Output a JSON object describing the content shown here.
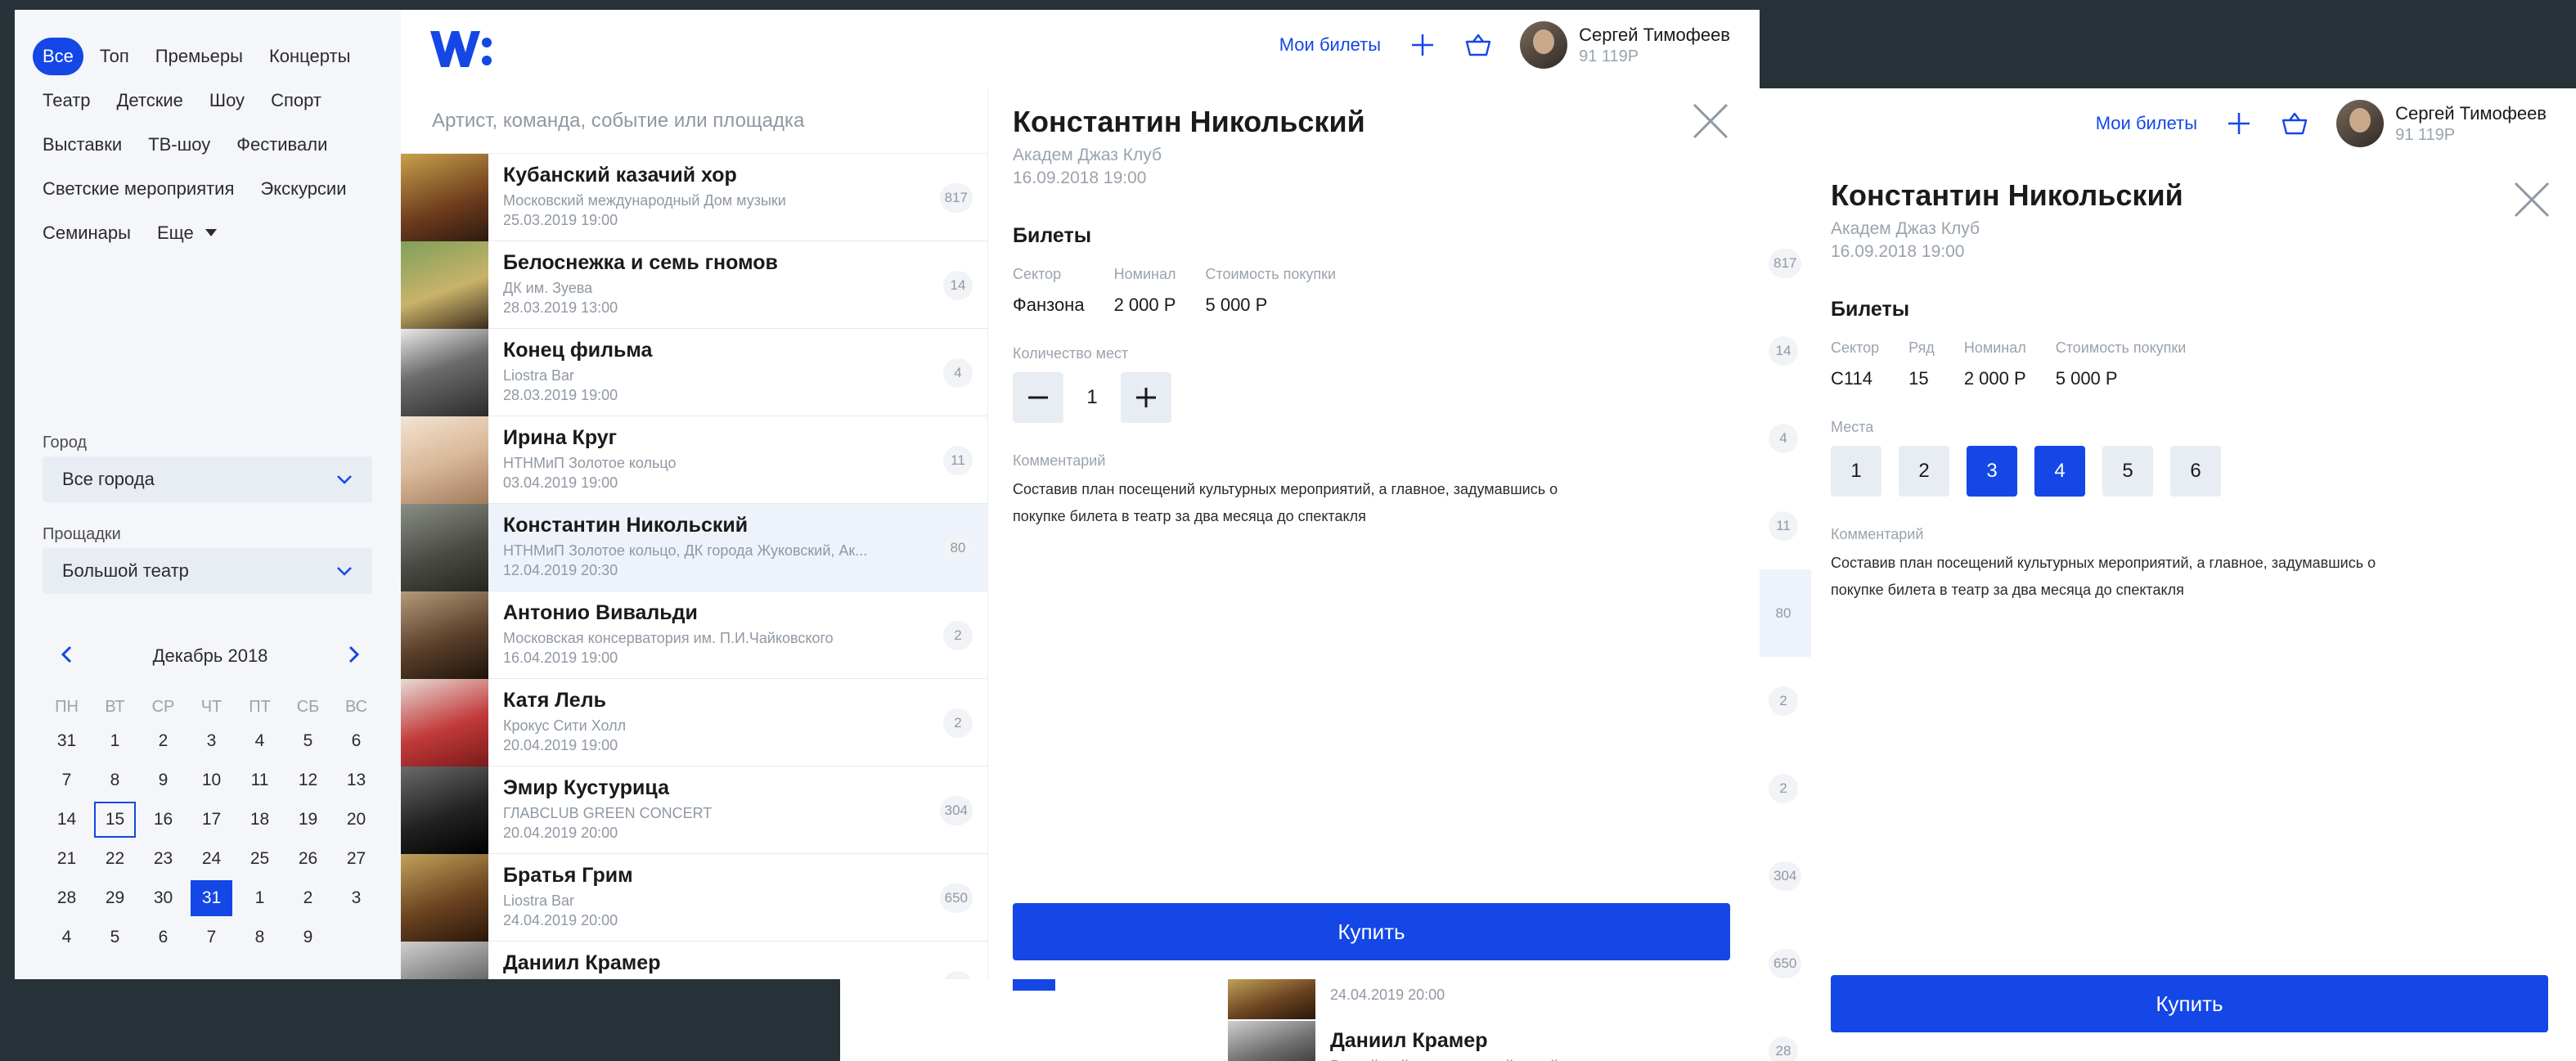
{
  "colors": {
    "accent": "#1447e6",
    "background": "#273238",
    "sidebar": "#f4f6f9"
  },
  "header": {
    "logo_text": "W:",
    "my_tickets": "Мои билеты",
    "user_name": "Сергей Тимофеев",
    "user_balance": "91 119Р",
    "icons": [
      "plus-icon",
      "basket-icon"
    ]
  },
  "sidebar": {
    "categories": [
      [
        "Все",
        "Топ",
        "Премьеры",
        "Концерты"
      ],
      [
        "Театр",
        "Детские",
        "Шоу",
        "Спорт"
      ],
      [
        "Выставки",
        "ТВ-шоу",
        "Фестивали"
      ],
      [
        "Светские мероприятия",
        "Экскурсии"
      ],
      [
        "Семинары",
        "Еще"
      ]
    ],
    "active_category": "Все",
    "city_label": "Город",
    "city_value": "Все города",
    "venue_label": "Прощадки",
    "venue_value": "Большой театр",
    "calendar": {
      "month": "Декабрь 2018",
      "weekdays": [
        "ПН",
        "ВТ",
        "СР",
        "ЧТ",
        "ПТ",
        "СБ",
        "ВС"
      ],
      "days": [
        "31",
        "1",
        "2",
        "3",
        "4",
        "5",
        "6",
        "7",
        "8",
        "9",
        "10",
        "11",
        "12",
        "13",
        "14",
        "15",
        "16",
        "17",
        "18",
        "19",
        "20",
        "21",
        "22",
        "23",
        "24",
        "25",
        "26",
        "27",
        "28",
        "29",
        "30",
        "31",
        "1",
        "2",
        "3",
        "4",
        "5",
        "6",
        "7",
        "8",
        "9"
      ],
      "today_index": 15,
      "selected_index": 31
    }
  },
  "search": {
    "placeholder": "Артист, команда, событие или площадка"
  },
  "events": [
    {
      "title": "Кубанский казачий хор",
      "venue": "Московский международный Дом музыки",
      "date": "25.03.2019  19:00",
      "count": "817"
    },
    {
      "title": "Белоснежка и семь гномов",
      "venue": "ДК им. Зуева",
      "date": "28.03.2019  13:00",
      "count": "14"
    },
    {
      "title": "Конец фильма",
      "venue": "Liostra Bar",
      "date": "28.03.2019  19:00",
      "count": "4"
    },
    {
      "title": "Ирина Круг",
      "venue": "НТНМиП Золотое кольцо",
      "date": "03.04.2019  19:00",
      "count": "11"
    },
    {
      "title": "Константин Никольский",
      "venue": "НТНМиП Золотое кольцо, ДК города Жуковский, Ак...",
      "date": "12.04.2019  20:30",
      "count": "80"
    },
    {
      "title": "Антонио Вивальди",
      "venue": "Московская консерватория им. П.И.Чайковского",
      "date": "16.04.2019  19:00",
      "count": "2"
    },
    {
      "title": "Катя Лель",
      "venue": "Крокус Сити Холл",
      "date": "20.04.2019  19:00",
      "count": "2"
    },
    {
      "title": "Эмир Кустурица",
      "venue": "ГЛАВCLUB GREEN CONCERT",
      "date": "20.04.2019  20:00",
      "count": "304"
    },
    {
      "title": "Братья Грим",
      "venue": "Liostra Bar",
      "date": "24.04.2019  20:00",
      "count": "650"
    },
    {
      "title": "Даниил Крамер",
      "venue": "Российский национальный музей музыки",
      "date": "",
      "count": "28"
    }
  ],
  "active_event_index": 4,
  "back_list": {
    "counts": [
      "817",
      "14",
      "4",
      "11",
      "80",
      "2",
      "2",
      "304",
      "650",
      "28"
    ],
    "calendar_rows": [
      [
        "4",
        "5",
        "6",
        "7",
        "8",
        "9"
      ]
    ],
    "partial_date": "24.04.2019  20:00",
    "partial_title": "Даниил Крамер",
    "partial_venue": "Российский национальный музей музыки"
  },
  "detail_front": {
    "title": "Константин Никольский",
    "venue": "Академ Джаз Клуб",
    "date": "16.09.2018 19:00",
    "tickets_heading": "Билеты",
    "table": {
      "headers": [
        "Сектор",
        "Номинал",
        "Стоимость покупки"
      ],
      "values": [
        "Фанзона",
        "2 000 Р",
        "5 000 Р"
      ]
    },
    "qty_label": "Количество мест",
    "qty_value": "1",
    "comment_label": "Комментарий",
    "comment_text": "Составив план посещений культурных мероприятий, а главное, задумавшись о покупке билета в театр за два месяца до спектакля",
    "buy_label": "Купить"
  },
  "detail_back": {
    "title": "Константин Никольский",
    "venue": "Академ Джаз Клуб",
    "date": "16.09.2018 19:00",
    "tickets_heading": "Билеты",
    "table": {
      "headers": [
        "Сектор",
        "Ряд",
        "Номинал",
        "Стоимость покупки"
      ],
      "values": [
        "С114",
        "15",
        "2 000 Р",
        "5 000 Р"
      ]
    },
    "seats_label": "Места",
    "seats": [
      "1",
      "2",
      "3",
      "4",
      "5",
      "6"
    ],
    "selected_seats": [
      "3",
      "4"
    ],
    "comment_label": "Комментарий",
    "comment_text": "Составив план посещений культурных мероприятий, а главное, задумавшись о покупке билета в театр за два месяца до спектакля",
    "buy_label": "Купить"
  }
}
